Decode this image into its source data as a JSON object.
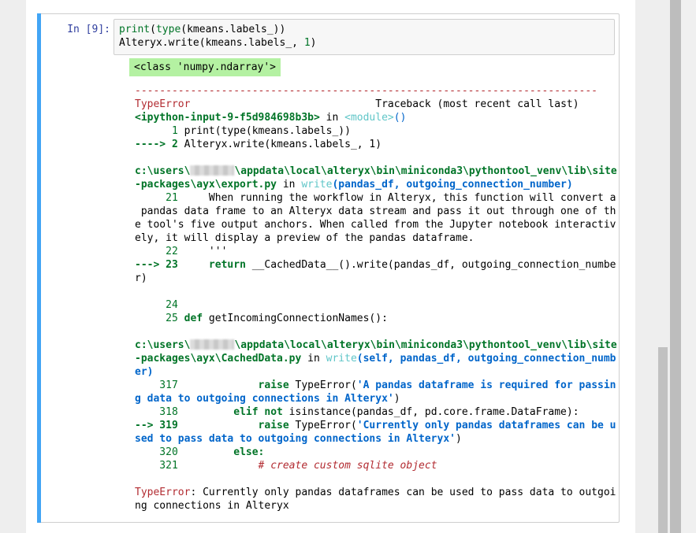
{
  "prompt": "In [9]:",
  "input_lines": [
    "print(type(kmeans.labels_))",
    "Alteryx.write(kmeans.labels_, 1)"
  ],
  "stdout": "<class 'numpy.ndarray'>",
  "traceback": {
    "dashes": "---------------------------------------------------------------------------",
    "error_name": "TypeError",
    "traceback_header": "Traceback (most recent call last)",
    "frame1_file": "<ipython-input-9-f5d984698b3b>",
    "frame1_in": " in ",
    "frame1_module": "<module>",
    "frame1_paren": "()",
    "frame1_l1_num": "      1 ",
    "frame1_l1_code": "print(type(kmeans.labels_))",
    "frame1_l2_arrow": "----> 2 ",
    "frame1_l2_code": "Alteryx.write(kmeans.labels_, 1)",
    "frame2_path_a": "c:\\users\\",
    "frame2_path_b": "\\appdata\\local\\alteryx\\bin\\miniconda3\\pythontool_venv\\lib\\site",
    "frame2_path_c": "-packages\\ayx\\export.py",
    "frame2_in": " in ",
    "frame2_func": "write",
    "frame2_args": "(pandas_df, outgoing_connection_number)",
    "frame2_l21_num": "     21 ",
    "frame2_l21_lines": [
      "    When running the workflow in Alteryx, this function will convert a",
      " pandas data frame to an Alteryx data stream and pass it out through one of th",
      "e tool's five output anchors. When called from the Jupyter notebook interactiv",
      "ely, it will display a preview of the pandas dataframe."
    ],
    "frame2_l22_num": "     22 ",
    "frame2_l22_code": "    '''",
    "frame2_l23_arrow": "---> 23 ",
    "frame2_l23_code_a": "    return",
    "frame2_l23_code_b": " __CachedData__().write(pandas_df, outgoing_connection_numbe",
    "frame2_l23_code_c": "r)",
    "frame2_l24_num": "     24 ",
    "frame2_l25_num": "     25 ",
    "frame2_l25_code_a": "def",
    "frame2_l25_code_b": " getIncomingConnectionNames():",
    "frame3_path_a": "c:\\users\\",
    "frame3_path_b": "\\appdata\\local\\alteryx\\bin\\miniconda3\\pythontool_venv\\lib\\site",
    "frame3_path_c": "-packages\\ayx\\CachedData.py",
    "frame3_in": " in ",
    "frame3_func": "write",
    "frame3_args": "(self, pandas_df, outgoing_connection_numb",
    "frame3_args2": "er)",
    "l317_num": "    317 ",
    "l317_code_a": "            raise",
    "l317_code_b": " TypeError(",
    "l317_str_a": "'A pandas dataframe is required for passin",
    "l317_str_b": "g data to outgoing connections in Alteryx'",
    "l317_close": ")",
    "l318_num": "    318 ",
    "l318_code_a": "        elif",
    "l318_code_b": " not",
    "l318_code_c": " isinstance(pandas_df, pd.core.frame.DataFrame):",
    "l319_arrow": "--> 319 ",
    "l319_code_a": "            raise",
    "l319_code_b": " TypeError(",
    "l319_str_a": "'Currently only pandas dataframes can be u",
    "l319_str_b": "sed to pass data to outgoing connections in Alteryx'",
    "l319_close": ")",
    "l320_num": "    320 ",
    "l320_code": "        else:",
    "l321_num": "    321 ",
    "l321_code": "            # create custom sqlite object",
    "final_error_name": "TypeError",
    "final_error_msg_a": ": Currently only pandas dataframes can be used to pass data to outgoi",
    "final_error_msg_b": "ng connections in Alteryx"
  }
}
